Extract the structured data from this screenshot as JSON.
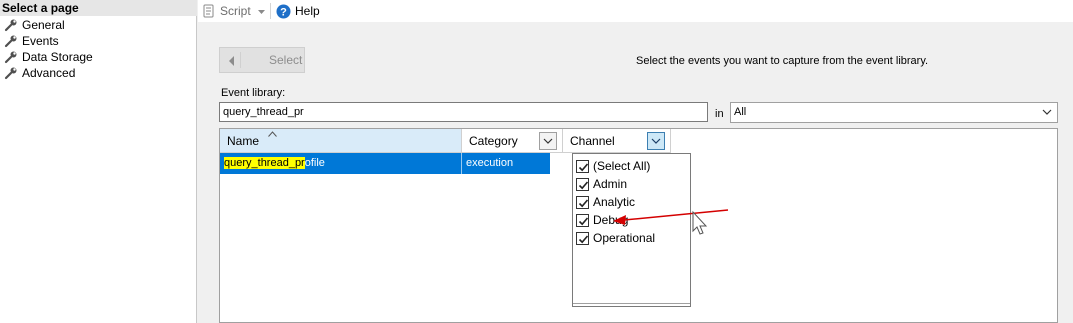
{
  "left_panel": {
    "header": "Select a page",
    "items": [
      {
        "label": "General"
      },
      {
        "label": "Events"
      },
      {
        "label": "Data Storage"
      },
      {
        "label": "Advanced"
      }
    ]
  },
  "toolbar": {
    "script_label": "Script",
    "help_label": "Help"
  },
  "main": {
    "select_button_label": "Select",
    "instructions": "Select the events you want to capture from the event library.",
    "event_library_label": "Event library:",
    "event_library_value": "query_thread_pr",
    "in_label": "in",
    "in_value": "All"
  },
  "grid": {
    "columns": [
      "Name",
      "Category",
      "Channel"
    ],
    "rows": [
      {
        "name_highlight": "query_thread_pr",
        "name_rest": "ofile",
        "category": "execution"
      }
    ]
  },
  "channel_filter": {
    "options": [
      {
        "label": "(Select All)",
        "checked": true
      },
      {
        "label": "Admin",
        "checked": true
      },
      {
        "label": "Analytic",
        "checked": true
      },
      {
        "label": "Debug",
        "checked": true
      },
      {
        "label": "Operational",
        "checked": true
      }
    ]
  },
  "colors": {
    "selection": "#0078d7",
    "highlight": "#ffff00",
    "annotation_arrow": "#d40000"
  }
}
